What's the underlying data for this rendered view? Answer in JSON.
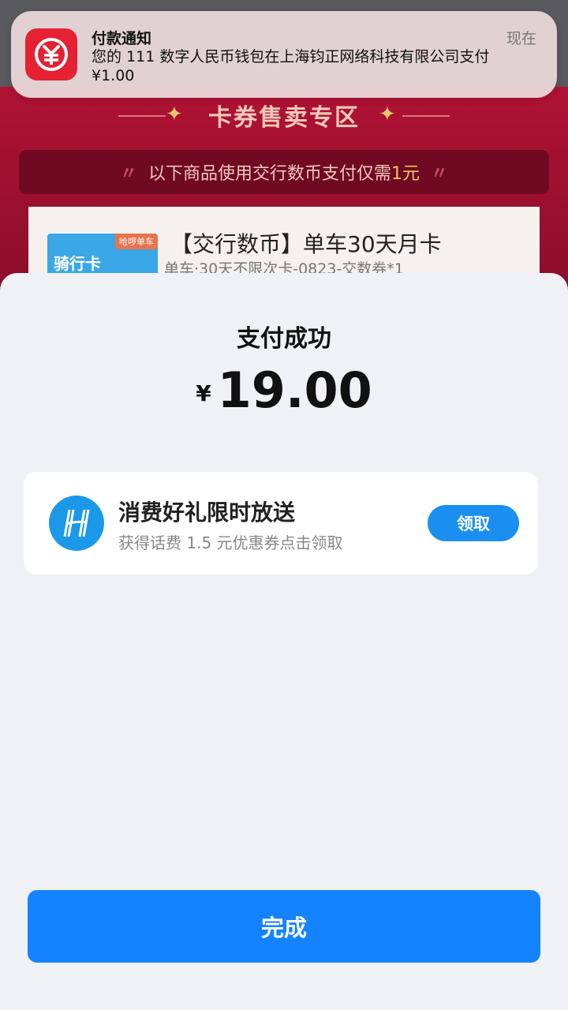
{
  "background": {
    "section_title": "卡券售卖专区",
    "promo_text": "以下商品使用交行数币支付仅需",
    "promo_highlight": "1元",
    "product": {
      "name": "【交行数币】单车30天月卡",
      "subtitle": "单车·30天不限次卡-0823-交数券*1",
      "thumb_tag": "哈啰单车",
      "thumb_text": "骑行卡"
    }
  },
  "notification": {
    "title": "付款通知",
    "time": "现在",
    "body": "您的 111 数字人民币钱包在上海钧正网络科技有限公司支付 ¥1.00",
    "icon": "digital-rmb-icon"
  },
  "payment": {
    "status": "支付成功",
    "currency": "¥",
    "amount": "19.00"
  },
  "gift": {
    "title": "消费好礼限时放送",
    "subtitle": "获得话费 1.5 元优惠券点击领取",
    "button": "领取",
    "icon": "hello-logo-icon"
  },
  "done_button": "完成",
  "colors": {
    "primary": "#1583ff",
    "brand_red": "#e52133",
    "background": "#eff1f5"
  }
}
